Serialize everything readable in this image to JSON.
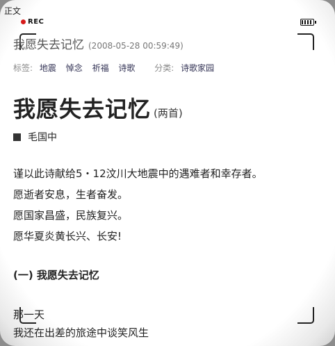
{
  "corner_label": "正文",
  "camera": {
    "rec": "REC"
  },
  "post": {
    "title": "我愿失去记忆",
    "date": "(2008-05-28 00:59:49)"
  },
  "tags": {
    "label": "标签:",
    "items": [
      "地震",
      "悼念",
      "祈福",
      "诗歌"
    ],
    "category_label": "分类:",
    "category": "诗歌家园"
  },
  "article": {
    "title": "我愿失去记忆",
    "subtitle": "(两首)",
    "author": "毛国中",
    "lines": [
      "谨以此诗献给5・12汶川大地震中的遇难者和幸存者。",
      "愿逝者安息，生者奋发。",
      "愿国家昌盛，民族复兴。",
      "愿华夏炎黄长兴、长安!"
    ],
    "section": "(一) 我愿失去记忆",
    "poem": [
      "那一天",
      "我还在出差的旅途中谈笑风生"
    ]
  },
  "colors": {
    "rec_dot": "#d61b1b",
    "frame": "#8c8c8c"
  }
}
